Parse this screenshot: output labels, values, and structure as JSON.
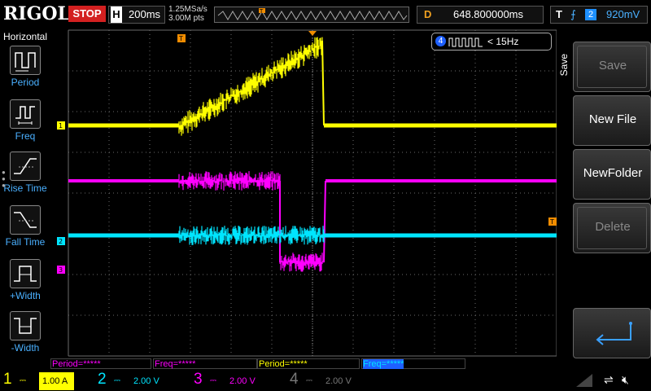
{
  "header": {
    "logo": "RIGOL",
    "run_state": "STOP",
    "timebase_label": "H",
    "timebase_value": "200ms",
    "sample_rate": "1.25MSa/s",
    "mem_depth": "3.00M pts",
    "delay_label": "D",
    "delay_value": "648.800000ms",
    "trigger_label": "T",
    "trigger_edge": "rising-edge-icon",
    "trigger_source": "2",
    "trigger_level": "920mV"
  },
  "left_menu": {
    "title": "Horizontal",
    "items": [
      {
        "label": "Period",
        "icon": "period-icon"
      },
      {
        "label": "Freq",
        "icon": "freq-icon"
      },
      {
        "label": "Rise Time",
        "icon": "rise-time-icon"
      },
      {
        "label": "Fall Time",
        "icon": "fall-time-icon"
      },
      {
        "label": "+Width",
        "icon": "positive-width-icon"
      },
      {
        "label": "-Width",
        "icon": "negative-width-icon"
      }
    ]
  },
  "right_menu": {
    "side_label": "Save",
    "buttons": [
      {
        "label": "Save",
        "enabled": false
      },
      {
        "label": "New File",
        "enabled": true
      },
      {
        "label": "NewFolder",
        "enabled": true
      },
      {
        "label": "Delete",
        "enabled": false
      }
    ],
    "enter_icon": "enter-return-icon"
  },
  "scope": {
    "counter_channel": "4",
    "counter_text": "< 15Hz",
    "trigger_marker": "T",
    "channel_markers": [
      "1",
      "2",
      "3"
    ],
    "colors": {
      "ch1": "#ffff00",
      "ch2": "#00e5ff",
      "ch3": "#ff00ff",
      "ch4": "#3a6cff",
      "grid": "#6a6a6a",
      "trigger": "#f08c00"
    }
  },
  "measurements": [
    {
      "text": "Period=*****",
      "color": "#ff00ff"
    },
    {
      "text": "Freq=*****",
      "color": "#ff00ff"
    },
    {
      "text": "Period=*****",
      "color": "#ffff00"
    },
    {
      "text": "Freq=*****",
      "color": "#00e5ff"
    }
  ],
  "channels": [
    {
      "num": "1",
      "coupling": "⎓",
      "scale": "1.00 A",
      "color": "#ffff00"
    },
    {
      "num": "2",
      "coupling": "⎓",
      "scale": "2.00 V",
      "color": "#00e5ff"
    },
    {
      "num": "3",
      "coupling": "⎓",
      "scale": "2.00 V",
      "color": "#ff00ff"
    },
    {
      "num": "4",
      "coupling": "⎓",
      "scale": "2.00 V",
      "color": "#777777"
    }
  ]
}
